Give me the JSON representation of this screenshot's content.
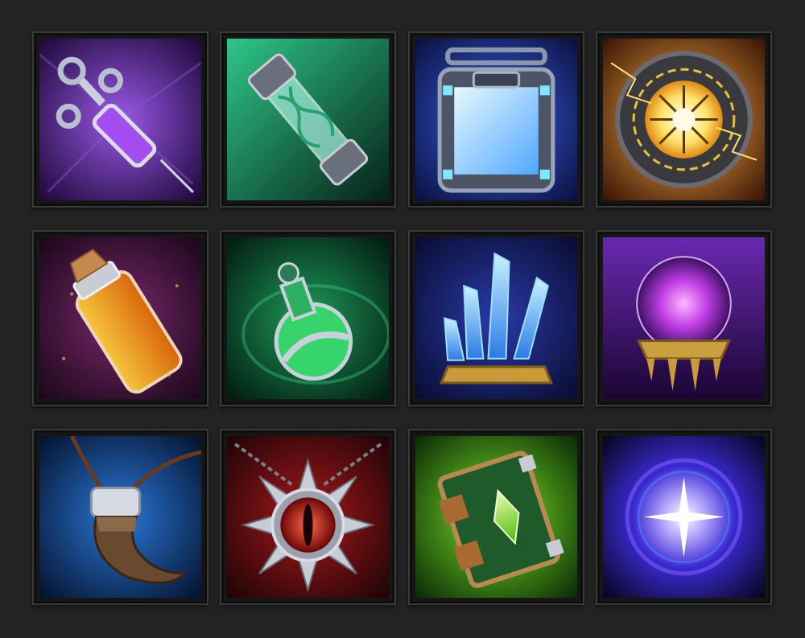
{
  "inventory": {
    "slots": [
      {
        "icon": "syringe-icon",
        "bg": "#5a1e9a",
        "accent": "#b06cff"
      },
      {
        "icon": "dna-tube-icon",
        "bg": "#0f6b4c",
        "accent": "#3fe6a6"
      },
      {
        "icon": "glass-container-icon",
        "bg": "#1b2e8f",
        "accent": "#7fd7ff"
      },
      {
        "icon": "sun-core-icon",
        "bg": "#b0520c",
        "accent": "#ffd84a"
      },
      {
        "icon": "orange-vial-icon",
        "bg": "#5a1a5e",
        "accent": "#ffa51c"
      },
      {
        "icon": "green-potion-icon",
        "bg": "#0b4a32",
        "accent": "#42e07a"
      },
      {
        "icon": "blue-crystals-icon",
        "bg": "#1a2a7a",
        "accent": "#6fd0ff"
      },
      {
        "icon": "crystal-ball-icon",
        "bg": "#3c0f6e",
        "accent": "#c86cff"
      },
      {
        "icon": "fang-necklace-icon",
        "bg": "#0e3f8a",
        "accent": "#4aa8ff"
      },
      {
        "icon": "eye-amulet-icon",
        "bg": "#6e0f12",
        "accent": "#ff3a2a"
      },
      {
        "icon": "spellbook-icon",
        "bg": "#2e7a0c",
        "accent": "#8cff3a"
      },
      {
        "icon": "star-vortex-icon",
        "bg": "#0d0d3a",
        "accent": "#6a5cff"
      }
    ]
  }
}
